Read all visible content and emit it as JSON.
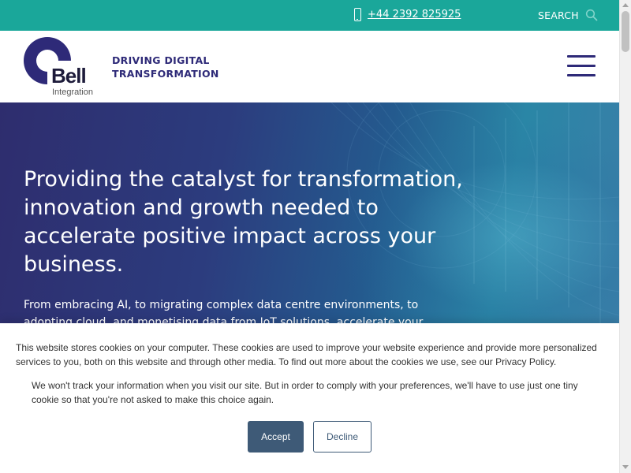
{
  "topbar": {
    "phone": "+44 2392 825925",
    "search_label": "SEARCH",
    "phone_icon": "mobile-phone-icon",
    "search_icon": "search-icon",
    "color": "#1aa79a"
  },
  "header": {
    "logo_text": "Bell",
    "logo_subtext": "Integration",
    "tagline_line1": "DRIVING DIGITAL",
    "tagline_line2": "TRANSFORMATION",
    "menu_icon": "hamburger-menu-icon",
    "brand_color": "#2e2a78"
  },
  "hero": {
    "title": "Providing the catalyst for transformation, innovation and growth needed to accelerate positive impact across your business.",
    "subtitle": "From embracing AI, to migrating complex data centre environments, to adopting cloud, and monetising data from IoT solutions, accelerate your journey and"
  },
  "cookie_banner": {
    "text1": "This website stores cookies on your computer. These cookies are used to improve your website experience and provide more personalized services to you, both on this website and through other media. To find out more about the cookies we use, see our Privacy Policy.",
    "text2": "We won't track your information when you visit our site. But in order to comply with your preferences, we'll have to use just one tiny cookie so that you're not asked to make this choice again.",
    "accept_label": "Accept",
    "decline_label": "Decline",
    "button_color": "#3e5a77"
  }
}
